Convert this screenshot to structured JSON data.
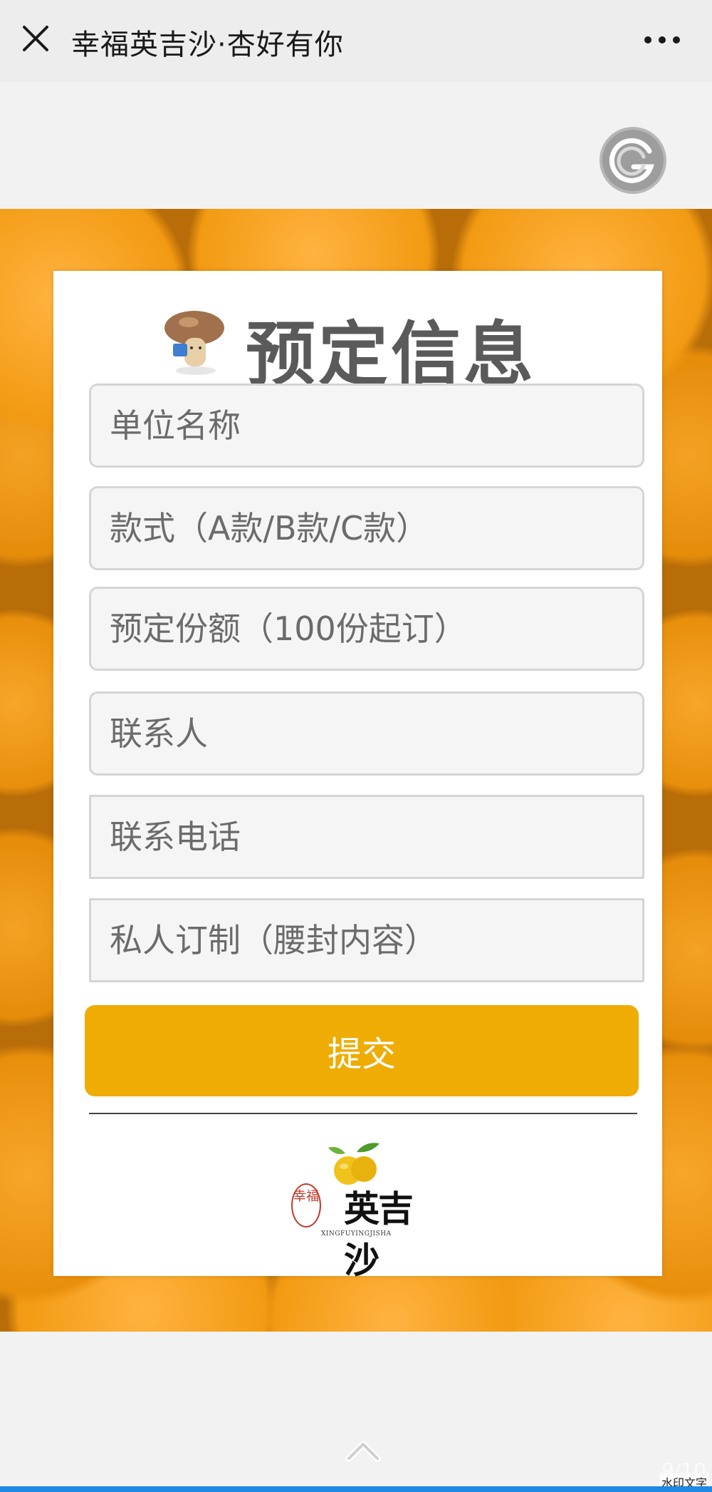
{
  "topbar": {
    "title": "幸福英吉沙·杏好有你",
    "close_icon": "close-icon",
    "more_icon": "more-icon"
  },
  "card": {
    "title": "预定信息",
    "fields": [
      {
        "placeholder": "单位名称",
        "value": ""
      },
      {
        "placeholder": "款式（A款/B款/C款）",
        "value": ""
      },
      {
        "placeholder": "预定份额（100份起订）",
        "value": ""
      },
      {
        "placeholder": "联系人",
        "value": ""
      },
      {
        "placeholder": "联系电话",
        "value": ""
      },
      {
        "placeholder": "私人订制（腰封内容）",
        "value": ""
      }
    ],
    "submit_label": "提交",
    "logo": {
      "name": "英吉沙",
      "seal": "幸福",
      "subtitle": "XINGFUYINGJISHA"
    }
  },
  "footer": {
    "page_indicator": "9/10",
    "watermark": "水印文字"
  },
  "colors": {
    "accent": "#eeac05",
    "title_gray": "#5a5a5a",
    "bottom_bar": "#1e88e5"
  }
}
